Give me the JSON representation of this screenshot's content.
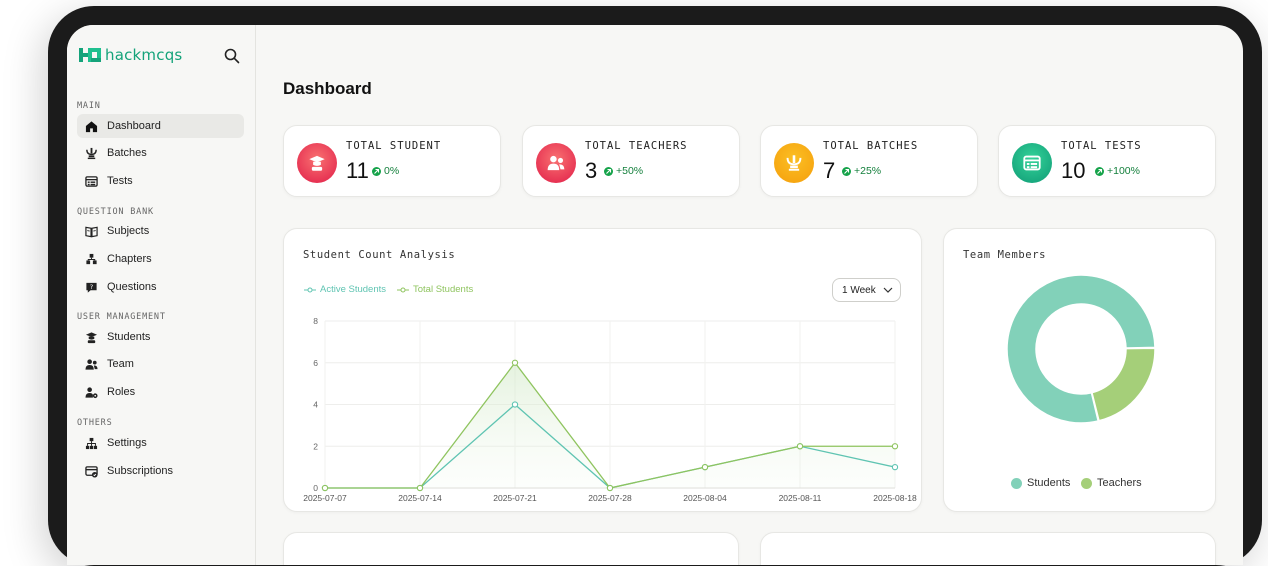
{
  "app": {
    "brand": "hackmcqs"
  },
  "sidebar": {
    "sections": [
      {
        "label": "MAIN",
        "items": [
          {
            "label": "Dashboard",
            "icon": "home-icon"
          },
          {
            "label": "Batches",
            "icon": "batches-icon"
          },
          {
            "label": "Tests",
            "icon": "tests-icon"
          }
        ]
      },
      {
        "label": "QUESTION BANK",
        "items": [
          {
            "label": "Subjects",
            "icon": "book-icon"
          },
          {
            "label": "Chapters",
            "icon": "chapters-icon"
          },
          {
            "label": "Questions",
            "icon": "questions-icon"
          }
        ]
      },
      {
        "label": "USER MANAGEMENT",
        "items": [
          {
            "label": "Students",
            "icon": "graduate-icon"
          },
          {
            "label": "Team",
            "icon": "team-icon"
          },
          {
            "label": "Roles",
            "icon": "roles-icon"
          }
        ]
      },
      {
        "label": "OTHERS",
        "items": [
          {
            "label": "Settings",
            "icon": "settings-icon"
          },
          {
            "label": "Subscriptions",
            "icon": "subscriptions-icon"
          }
        ]
      }
    ],
    "active": "Dashboard"
  },
  "page": {
    "title": "Dashboard"
  },
  "stats": [
    {
      "label": "TOTAL STUDENT",
      "value": "11",
      "change": "0%",
      "icon": "graduate-icon",
      "color": "#ef4444"
    },
    {
      "label": "TOTAL TEACHERS",
      "value": "3",
      "change": "+50%",
      "icon": "users-icon",
      "color": "#ef4444"
    },
    {
      "label": "TOTAL BATCHES",
      "value": "7",
      "change": "+25%",
      "icon": "batches-icon",
      "color": "#f59e0b"
    },
    {
      "label": "TOTAL TESTS",
      "value": "10",
      "change": "+100%",
      "icon": "tests-icon",
      "color": "#10a37f"
    }
  ],
  "student_chart": {
    "title": "Student Count Analysis",
    "range_select": "1 Week",
    "chart_data": {
      "type": "line",
      "x": [
        "2025-07-07",
        "2025-07-14",
        "2025-07-21",
        "2025-07-28",
        "2025-08-04",
        "2025-08-11",
        "2025-08-18"
      ],
      "series": [
        {
          "name": "Active Students",
          "color": "#5fc4b2",
          "values": [
            0,
            0,
            4,
            0,
            1,
            2,
            1
          ]
        },
        {
          "name": "Total Students",
          "color": "#8fc45f",
          "values": [
            0,
            0,
            6,
            0,
            1,
            2,
            2
          ]
        }
      ],
      "yticks": [
        0,
        2,
        4,
        6,
        8
      ],
      "ylim": [
        0,
        8
      ],
      "legend": "top-left",
      "grid": true
    }
  },
  "team_chart": {
    "title": "Team Members",
    "chart_data": {
      "type": "pie",
      "labels": [
        "Students",
        "Teachers"
      ],
      "values": [
        11,
        3
      ],
      "colors": [
        "#82d1b9",
        "#a5cf79"
      ],
      "legend": "bottom"
    }
  }
}
